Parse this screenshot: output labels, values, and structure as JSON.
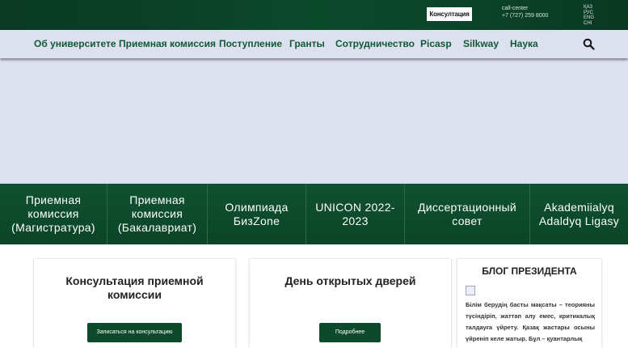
{
  "topbar": {
    "consult_label": "Консултация",
    "call_center_label": "call-center",
    "phone": "+7 (727) 259 8000",
    "languages": [
      "ҚАЗ",
      "РУС",
      "ENG",
      "CHI"
    ]
  },
  "nav": {
    "items": [
      "Об университете",
      "Приемная комиссия",
      "Поступление",
      "Гранты",
      "Сотрудничество",
      "Picasp",
      "Silkway",
      "Наука"
    ]
  },
  "tiles": [
    "Приемная комиссия (Магистратура)",
    "Приемная комиссия (Бакалавриат)",
    "Олимпиада БизZone",
    "UNICON 2022-2023",
    "Диссертационный совет",
    "Akademiialyq Adaldyq Ligasy"
  ],
  "cards": {
    "consult": {
      "title": "Консультация приемной комиссии",
      "button": "Записаться на консультацию"
    },
    "open_day": {
      "title": "День открытых дверей",
      "button": "Подробнее"
    },
    "blog": {
      "title": "БЛОГ ПРЕЗИДЕНТА",
      "text": "Білім берудің басты мақсаты – теорияны түсіндіріп, жаттап алу емес, критикалық талдауға үйрету. Қазақ жастары осыны үйреніп келе жатыр. Бұл – қуантарлық"
    }
  },
  "colors": {
    "brand_green": "#0d4a2b",
    "nav_text": "#0e5a34",
    "nav_bg": "#dde0ef"
  }
}
